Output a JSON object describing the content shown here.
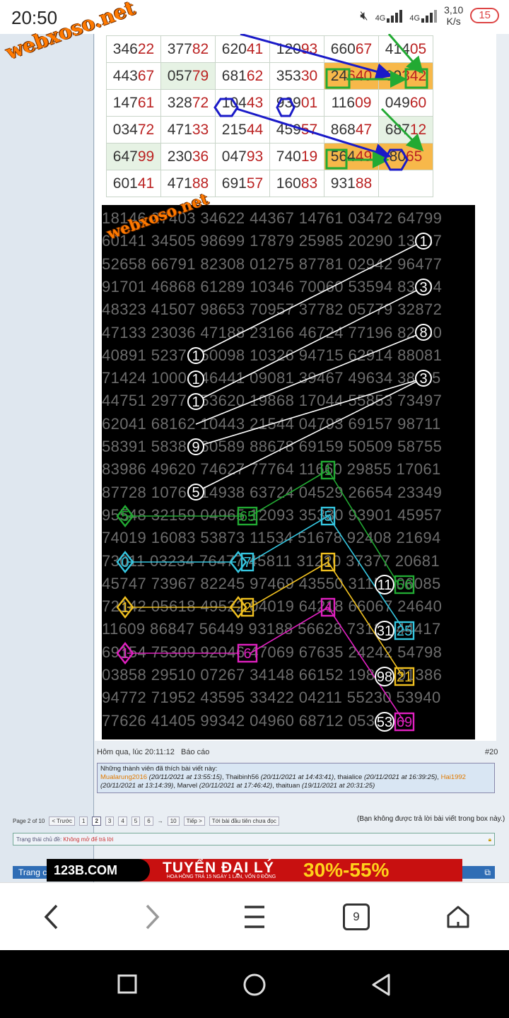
{
  "status_bar": {
    "time": "20:50",
    "net1": "4G",
    "net2": "4G",
    "speed_value": "3,10",
    "speed_unit": "K/s",
    "battery": "15"
  },
  "watermark": "webxoso.net",
  "results_table": {
    "rows": [
      [
        [
          "346",
          "22"
        ],
        [
          "377",
          "82"
        ],
        [
          "620",
          "41"
        ],
        [
          "120",
          "93"
        ],
        [
          "660",
          "67"
        ],
        [
          "414",
          "05"
        ]
      ],
      [
        [
          "443",
          "67"
        ],
        [
          "057",
          "79"
        ],
        [
          "681",
          "62"
        ],
        [
          "353",
          "30"
        ],
        [
          "24",
          "640"
        ],
        [
          "99",
          "342"
        ]
      ],
      [
        [
          "147",
          "61"
        ],
        [
          "328",
          "72"
        ],
        [
          "104",
          "43"
        ],
        [
          "939",
          "01"
        ],
        [
          "116",
          "09"
        ],
        [
          "049",
          "60"
        ]
      ],
      [
        [
          "034",
          "72"
        ],
        [
          "471",
          "33"
        ],
        [
          "215",
          "44"
        ],
        [
          "459",
          "57"
        ],
        [
          "868",
          "47"
        ],
        [
          "687",
          "12"
        ]
      ],
      [
        [
          "647",
          "99"
        ],
        [
          "230",
          "36"
        ],
        [
          "047",
          "93"
        ],
        [
          "740",
          "19"
        ],
        [
          "564",
          "49"
        ],
        [
          "80",
          "65"
        ]
      ],
      [
        [
          "601",
          "41"
        ],
        [
          "471",
          "88"
        ],
        [
          "691",
          "57"
        ],
        [
          "160",
          "83"
        ],
        [
          "931",
          "88"
        ],
        [
          "",
          ""
        ]
      ]
    ]
  },
  "number_grid": {
    "rows": [
      "18146 27403 34622 44367 14761 03472 64799",
      "60141 34505 98699 17879 25985 20290 13987",
      "52658 66791 82308 01275 87781 02942 96477",
      "91701 46868 61289 10346 70060 53594 83294",
      "48323 41507 98653 70957 37782 05779 32872",
      "47133 23036 47188 23166 46724 77196 82380",
      "40891 52371 50098 10326 94715 62914 88081",
      "71424 10004 46441 09081 39467 49634 38115",
      "44751 29771 53620 19868 17044 55853 73497",
      "62041 68162 10443 21544 04793 69157 98711",
      "58391 58389 60589 88678 69159 50509 58755",
      "83986 49620 74627 77764 11660 29855 17061",
      "87728 10765 14938 63724 04529 26654 23349",
      "95548 32159 04965 12093 35330 93901 45957",
      "74019 16083 53873 11534 51678 92408 21694",
      "73011 03234 76477 45811 31220 37377 20681",
      "45747 73967 82245 97469 43550 31156 06085",
      "72142 05618 49522 04019 64218 66067 24640",
      "11609 86847 56449 93188 56628 73125 44417",
      "69154 75309 92046 47069 67635 24242 54798",
      "03858 29510 07267 34148 66152 19821 91386",
      "94772 71952 43595 33422 04211 55230 53940",
      "77626 41405 99342 04960 68712 05369"
    ],
    "circle_marks": [
      "1",
      "1",
      "1",
      "9",
      "5",
      "1",
      "3",
      "8",
      "3",
      "11",
      "31",
      "98",
      "53"
    ],
    "box_marks": [
      "1",
      "56",
      "5",
      "25",
      "1",
      "21",
      "4",
      "69",
      "65",
      "7",
      "2",
      "6"
    ],
    "diamond_marks": [
      "5",
      "0",
      "1",
      "1"
    ]
  },
  "post_meta": {
    "posted": "Hôm qua, lúc 20:11:12",
    "report": "Báo cáo",
    "post_number": "#20"
  },
  "likes": {
    "heading": "Những thành viên đã thích bài viết này:",
    "entries": [
      {
        "user": "Mualarung2016",
        "time": "(20/11/2021 at 13:55:15)",
        "highlight": true
      },
      {
        "user": "Thaibinh56",
        "time": "(20/11/2021 at 14:43:41)",
        "highlight": false
      },
      {
        "user": "thaialice",
        "time": "(20/11/2021 at 16:39:25)",
        "highlight": false
      },
      {
        "user": "Hai1992",
        "time": "(20/11/2021 at 13:14:39)",
        "highlight": true
      },
      {
        "user": "Marvel",
        "time": "(20/11/2021 at 17:46:42)",
        "highlight": false
      },
      {
        "user": "thaituan",
        "time": "(19/11/2021 at 20:31:25)",
        "highlight": false
      }
    ]
  },
  "pagination": {
    "label": "Page 2 of 10",
    "prev": "< Trước",
    "pages": [
      "1",
      "2",
      "3",
      "4",
      "5",
      "6"
    ],
    "arrow": "→",
    "last": "10",
    "next": "Tiếp >",
    "first_unread": "Tới bài đầu tiên chưa đọc",
    "current": "2"
  },
  "no_reply": "(Bạn không được trả lời bài viết trong box này.)",
  "thread_status": {
    "label": "Trạng thái chủ đề:",
    "value": "Không mở để trả lời"
  },
  "footer_label": "Trang c",
  "ad": {
    "logo": "123B.COM",
    "title": "TUYỂN ĐẠI LÝ",
    "percent": "30%-55%",
    "sub": "HOA HỒNG TRẢ 15 NGÀY 1 LẦN, VỐN 0 ĐỒNG"
  },
  "browser_nav": {
    "tabs_count": "9"
  },
  "colors": {
    "accent_orange": "#ff7a00",
    "table_orange": "#f7b84a",
    "arrow_blue": "#1a1ac8",
    "arrow_green": "#22aa33",
    "mark_cyan": "#35c6e0",
    "mark_yellow": "#f0c020",
    "mark_magenta": "#e020c0"
  }
}
